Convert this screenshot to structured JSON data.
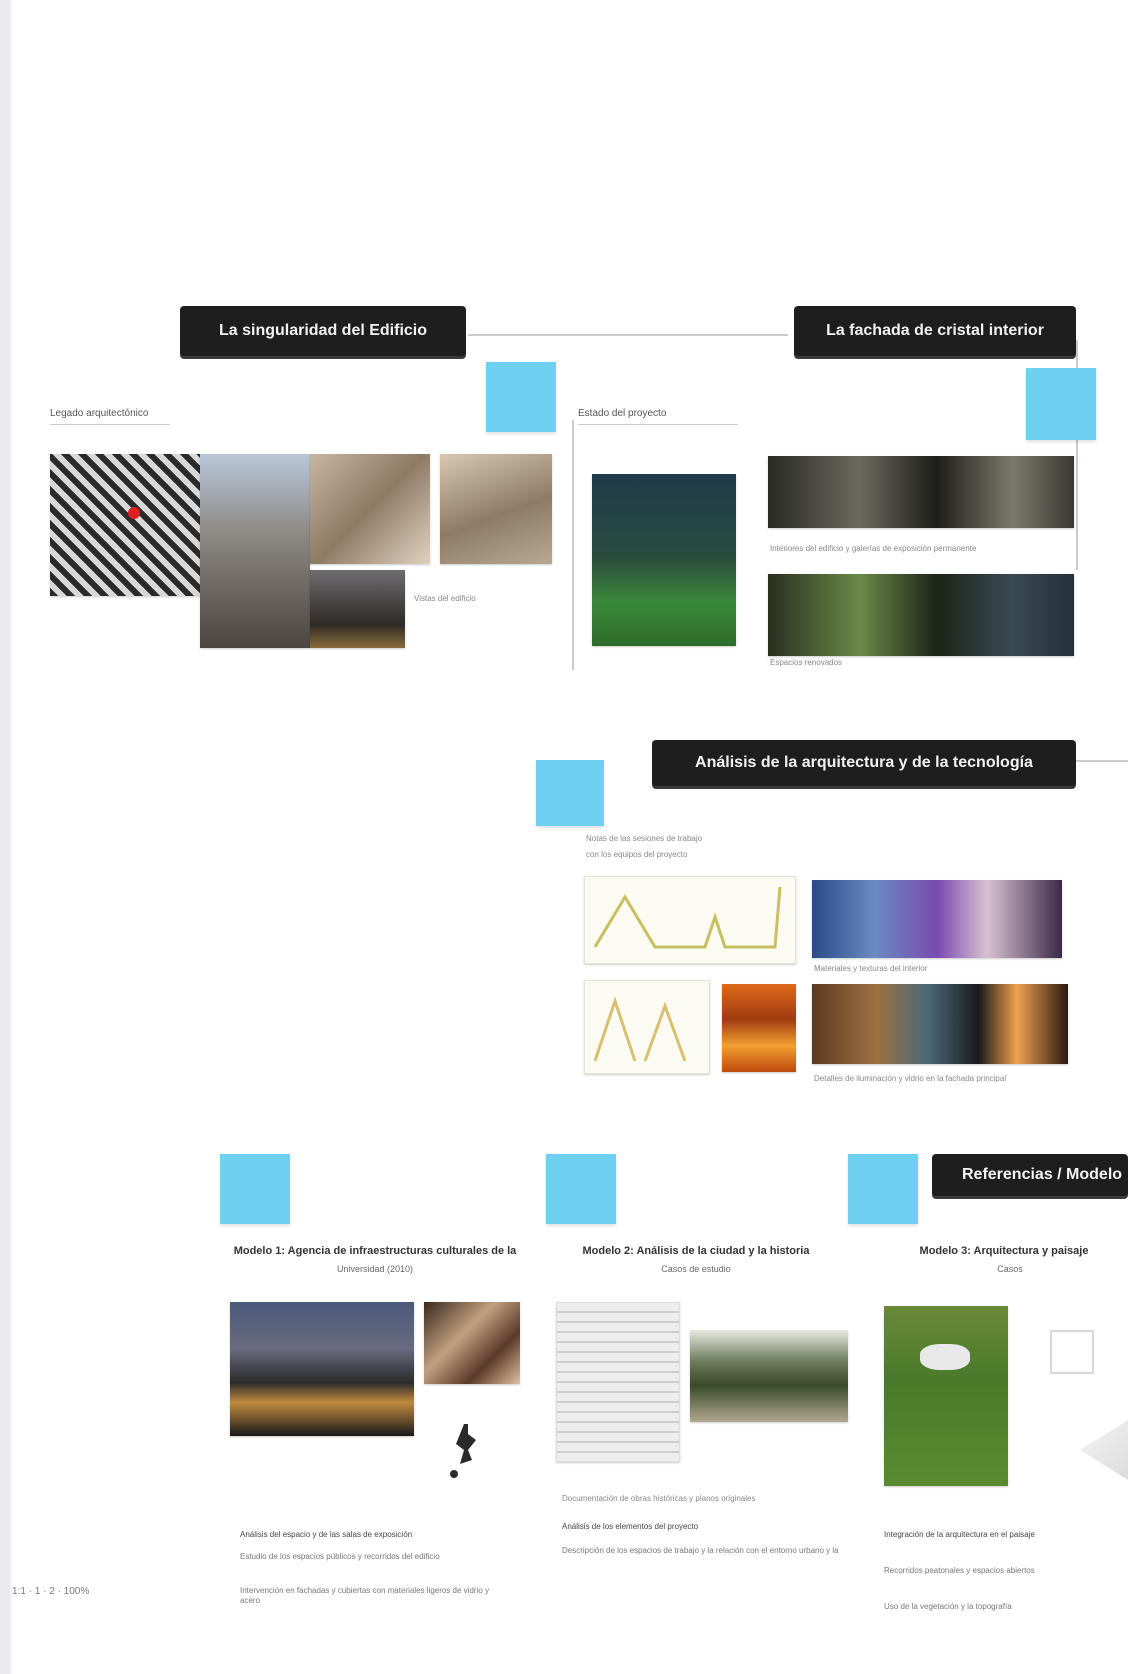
{
  "sections": {
    "s1": {
      "title": "La singularidad del Edificio",
      "caption": "Legado arquitectónico",
      "photo_note": "Vistas del edificio"
    },
    "s2": {
      "title": "La fachada de cristal interior",
      "caption": "Estado del proyecto",
      "photo_note_1": "Interiores del edificio y galerías de exposición permanente",
      "photo_note_2": "Espacios renovados"
    },
    "s3": {
      "title": "Análisis de la arquitectura y de la tecnología",
      "caption_1": "Notas de las sesiones de trabajo",
      "caption_2": "con los equipos del proyecto",
      "photo_note_1": "Materiales y texturas del interior",
      "photo_note_2": "Detalles de iluminación y vidrio en la fachada principal"
    },
    "s4": {
      "title": "Referencias / Modelo"
    },
    "col1": {
      "heading": "Modelo 1: Agencia de infraestructuras culturales de la",
      "sub": "Universidad (2010)",
      "bullet": "Análisis del espacio y de las salas de exposición",
      "para1": "Estudio de los espacios públicos y recorridos del edificio",
      "para2": "Intervención en fachadas y cubiertas con materiales ligeros de vidrio y acero"
    },
    "col2": {
      "heading": "Modelo 2: Análisis de la ciudad y la historia",
      "sub": "Casos de estudio",
      "note": "Documentación de obras históricas y planos originales",
      "bullet": "Análisis de los elementos del proyecto",
      "para1": "Descripción de los espacios de trabajo y la relación con el entorno urbano y la"
    },
    "col3": {
      "heading": "Modelo 3: Arquitectura y paisaje",
      "sub": "Casos",
      "bullet": "Integración de la arquitectura en el paisaje",
      "para1": "Recorridos peatonales y espacios abiertos",
      "para2": "Uso de la vegetación y la topografía"
    },
    "footer": {
      "text": "1:1 · 1 · 2 · 100%"
    }
  },
  "colors": {
    "title_bg": "#1e1e1e",
    "sticky": "#6fd0f2",
    "connector": "#c9c9cf"
  },
  "icons": {
    "pin": "map-pin-icon"
  }
}
